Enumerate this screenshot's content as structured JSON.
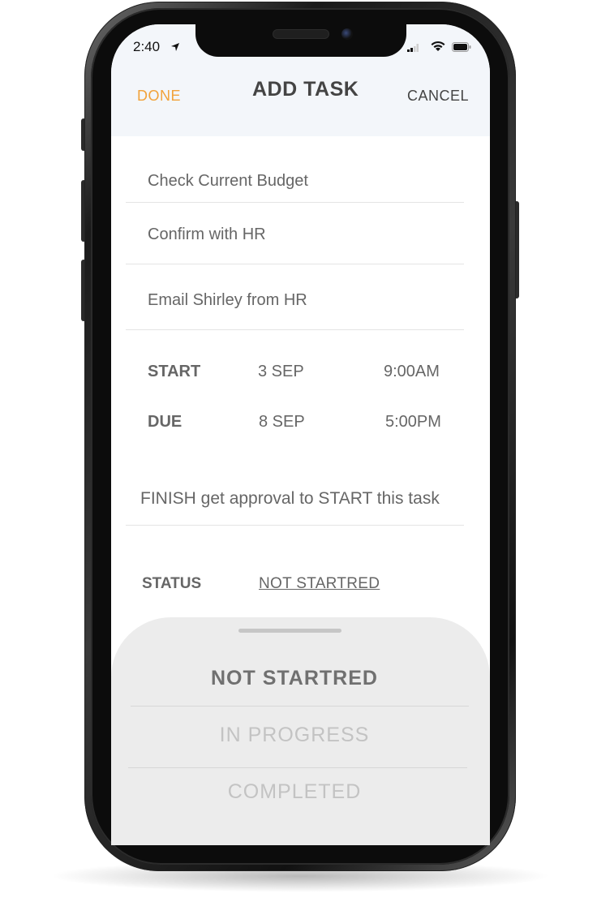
{
  "status_bar": {
    "time": "2:40",
    "icons": [
      "location-arrow-icon",
      "cellular-signal-icon",
      "wifi-icon",
      "battery-icon"
    ]
  },
  "header": {
    "done_label": "DONE",
    "title": "ADD TASK",
    "cancel_label": "CANCEL"
  },
  "tasks": [
    {
      "text": "Check Current Budget"
    },
    {
      "text": "Confirm with HR"
    },
    {
      "text": "Email Shirley from HR"
    }
  ],
  "schedule": {
    "start": {
      "label": "START",
      "date": "3 SEP",
      "time": "9:00AM"
    },
    "due": {
      "label": "DUE",
      "date": "8 SEP",
      "time": "5:00PM"
    }
  },
  "note": "FINISH get approval to START this task",
  "status": {
    "label": "STATUS",
    "value": "NOT STARTRED"
  },
  "picker": {
    "options": [
      "NOT STARTRED",
      "IN PROGRESS",
      "COMPLETED"
    ],
    "selected": "NOT STARTRED"
  },
  "colors": {
    "accent": "#f2a23a",
    "header_bg": "#f3f6fa",
    "text": "#666666",
    "sheet_bg": "#ececec"
  }
}
